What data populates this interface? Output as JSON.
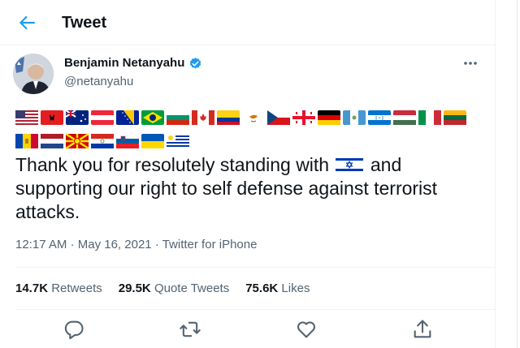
{
  "header": {
    "title": "Tweet"
  },
  "tweet": {
    "author_name": "Benjamin Netanyahu",
    "handle": "@netanyahu",
    "text_before_flag": "Thank you for resolutely standing with",
    "text_after_flag": "and supporting our right to self defense against terrorist attacks.",
    "time": "12:17 AM",
    "date": "May 16, 2021",
    "source": "Twitter for iPhone"
  },
  "stats": {
    "retweets_count": "14.7K",
    "retweets_label": "Retweets",
    "quotes_count": "29.5K",
    "quotes_label": "Quote Tweets",
    "likes_count": "75.6K",
    "likes_label": "Likes"
  },
  "flags_row1": [
    "united-states",
    "albania",
    "australia",
    "austria",
    "bosnia-herzegovina",
    "brazil",
    "bulgaria",
    "canada",
    "colombia",
    "cyprus",
    "czechia",
    "georgia",
    "germany",
    "guatemala",
    "honduras",
    "hungary",
    "italy",
    "lithuania"
  ],
  "flags_row2": [
    "moldova",
    "netherlands",
    "north-macedonia",
    "paraguay",
    "slovenia",
    "ukraine",
    "uruguay"
  ],
  "inline_flag": "israel",
  "colors": {
    "accent": "#1d9bf0",
    "secondary_text": "#536471",
    "primary_text": "#0f1419"
  }
}
